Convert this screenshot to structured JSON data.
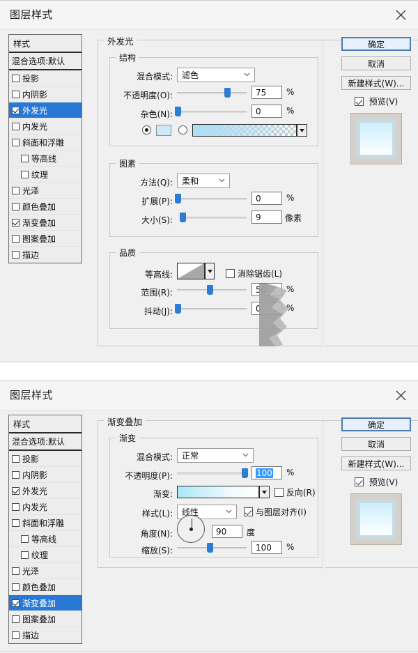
{
  "dialog1": {
    "title": "图层样式",
    "close_icon": "close-icon",
    "styles_panel": {
      "header": "样式",
      "blending": "混合选项:默认",
      "items": [
        {
          "label": "投影",
          "checked": false,
          "selected": false,
          "indent": false
        },
        {
          "label": "内阴影",
          "checked": false,
          "selected": false,
          "indent": false
        },
        {
          "label": "外发光",
          "checked": true,
          "selected": true,
          "indent": false
        },
        {
          "label": "内发光",
          "checked": false,
          "selected": false,
          "indent": false
        },
        {
          "label": "斜面和浮雕",
          "checked": false,
          "selected": false,
          "indent": false
        },
        {
          "label": "等高线",
          "checked": false,
          "selected": false,
          "indent": true
        },
        {
          "label": "纹理",
          "checked": false,
          "selected": false,
          "indent": true
        },
        {
          "label": "光泽",
          "checked": false,
          "selected": false,
          "indent": false
        },
        {
          "label": "颜色叠加",
          "checked": false,
          "selected": false,
          "indent": false
        },
        {
          "label": "渐变叠加",
          "checked": true,
          "selected": false,
          "indent": false
        },
        {
          "label": "图案叠加",
          "checked": false,
          "selected": false,
          "indent": false
        },
        {
          "label": "描边",
          "checked": false,
          "selected": false,
          "indent": false
        }
      ]
    },
    "panel_title": "外发光",
    "structure": {
      "legend": "结构",
      "blend_mode_label": "混合模式:",
      "blend_mode_value": "滤色",
      "opacity_label": "不透明度(O):",
      "opacity_value": "75",
      "opacity_unit": "%",
      "noise_label": "杂色(N):",
      "noise_value": "0",
      "noise_unit": "%",
      "color_radio_selected": true,
      "gradient_radio_selected": false
    },
    "elements": {
      "legend": "图素",
      "technique_label": "方法(Q):",
      "technique_value": "柔和",
      "spread_label": "扩展(P):",
      "spread_value": "0",
      "spread_unit": "%",
      "size_label": "大小(S):",
      "size_value": "9",
      "size_unit": "像素"
    },
    "quality": {
      "legend": "品质",
      "contour_label": "等高线:",
      "antialias_label": "消除锯齿(L)",
      "antialias_checked": false,
      "range_label": "范围(R):",
      "range_value": "50",
      "range_unit": "%",
      "jitter_label": "抖动(J):",
      "jitter_value": "0",
      "jitter_unit": "%"
    },
    "buttons": {
      "ok": "确定",
      "cancel": "取消",
      "new_style": "新建样式(W)...",
      "preview": "预览(V)",
      "preview_checked": true
    }
  },
  "dialog2": {
    "title": "图层样式",
    "close_icon": "close-icon",
    "styles_panel": {
      "header": "样式",
      "blending": "混合选项:默认",
      "items": [
        {
          "label": "投影",
          "checked": false,
          "selected": false,
          "indent": false
        },
        {
          "label": "内阴影",
          "checked": false,
          "selected": false,
          "indent": false
        },
        {
          "label": "外发光",
          "checked": true,
          "selected": false,
          "indent": false
        },
        {
          "label": "内发光",
          "checked": false,
          "selected": false,
          "indent": false
        },
        {
          "label": "斜面和浮雕",
          "checked": false,
          "selected": false,
          "indent": false
        },
        {
          "label": "等高线",
          "checked": false,
          "selected": false,
          "indent": true
        },
        {
          "label": "纹理",
          "checked": false,
          "selected": false,
          "indent": true
        },
        {
          "label": "光泽",
          "checked": false,
          "selected": false,
          "indent": false
        },
        {
          "label": "颜色叠加",
          "checked": false,
          "selected": false,
          "indent": false
        },
        {
          "label": "渐变叠加",
          "checked": true,
          "selected": true,
          "indent": false
        },
        {
          "label": "图案叠加",
          "checked": false,
          "selected": false,
          "indent": false
        },
        {
          "label": "描边",
          "checked": false,
          "selected": false,
          "indent": false
        }
      ]
    },
    "panel_title": "渐变叠加",
    "gradient": {
      "legend": "渐变",
      "blend_mode_label": "混合模式:",
      "blend_mode_value": "正常",
      "opacity_label": "不透明度(P):",
      "opacity_value": "100",
      "opacity_unit": "%",
      "gradient_label": "渐变:",
      "reverse_label": "反向(R)",
      "reverse_checked": false,
      "style_label": "样式(L):",
      "style_value": "线性",
      "align_label": "与图层对齐(I)",
      "align_checked": true,
      "angle_label": "角度(N):",
      "angle_value": "90",
      "angle_unit": "度",
      "scale_label": "缩放(S):",
      "scale_value": "100",
      "scale_unit": "%"
    },
    "buttons": {
      "ok": "确定",
      "cancel": "取消",
      "new_style": "新建样式(W)...",
      "preview": "预览(V)",
      "preview_checked": true
    }
  },
  "colors": {
    "selection_blue": "#2979d4",
    "slider_blue": "#2b7cd3",
    "dialog_bg": "#f0f0f0",
    "glow_color": "#cfeaf8",
    "gradient_start": "#a8e8f7",
    "gradient_end": "#ffffff"
  }
}
